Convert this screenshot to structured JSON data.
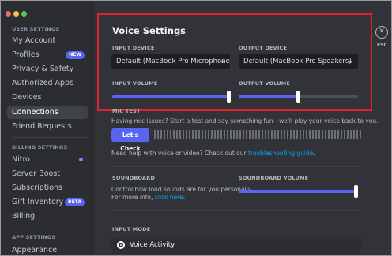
{
  "window": {
    "dots": [
      "#ed6a5e",
      "#f4bf4f",
      "#61c554"
    ]
  },
  "sidebar": {
    "user_settings_header": "USER SETTINGS",
    "user_items": [
      {
        "label": "My Account"
      },
      {
        "label": "Profiles",
        "badge": "NEW"
      },
      {
        "label": "Privacy & Safety"
      },
      {
        "label": "Authorized Apps"
      },
      {
        "label": "Devices"
      },
      {
        "label": "Connections",
        "active": true
      },
      {
        "label": "Friend Requests"
      }
    ],
    "billing_header": "BILLING SETTINGS",
    "billing_items": [
      {
        "label": "Nitro"
      },
      {
        "label": "Server Boost"
      },
      {
        "label": "Subscriptions"
      },
      {
        "label": "Gift Inventory",
        "badge": "BETA"
      },
      {
        "label": "Billing"
      }
    ],
    "app_header": "APP SETTINGS",
    "app_items": [
      {
        "label": "Appearance"
      }
    ]
  },
  "voice": {
    "title": "Voice Settings",
    "input_device_label": "INPUT DEVICE",
    "input_device_value": "Default (MacBook Pro Microphone)",
    "output_device_label": "OUTPUT DEVICE",
    "output_device_value": "Default (MacBook Pro Speakers)",
    "input_volume_label": "INPUT VOLUME",
    "input_volume": 0.99,
    "output_volume_label": "OUTPUT VOLUME",
    "output_volume": 0.5
  },
  "mic_test": {
    "label": "MIC TEST",
    "description": "Having mic issues? Start a test and say something fun—we'll play your voice back to you.",
    "button": "Let's Check",
    "help_prefix": "Need help with voice or video? Check out our ",
    "help_link": "troubleshooting guide",
    "help_suffix": "."
  },
  "soundboard": {
    "label": "SOUNDBOARD",
    "description_line1": "Control how loud sounds are for you personally.",
    "description_line2_prefix": "For more info, ",
    "description_link": "click here",
    "description_suffix": ".",
    "volume_label": "SOUNDBOARD VOLUME",
    "volume": 0.99
  },
  "input_mode": {
    "label": "INPUT MODE",
    "option": "Voice Activity"
  },
  "close": {
    "icon": "✕",
    "label": "ESC"
  },
  "colors": {
    "accent": "#5865f2",
    "highlight": "#e0202a",
    "link": "#00a8fc"
  }
}
